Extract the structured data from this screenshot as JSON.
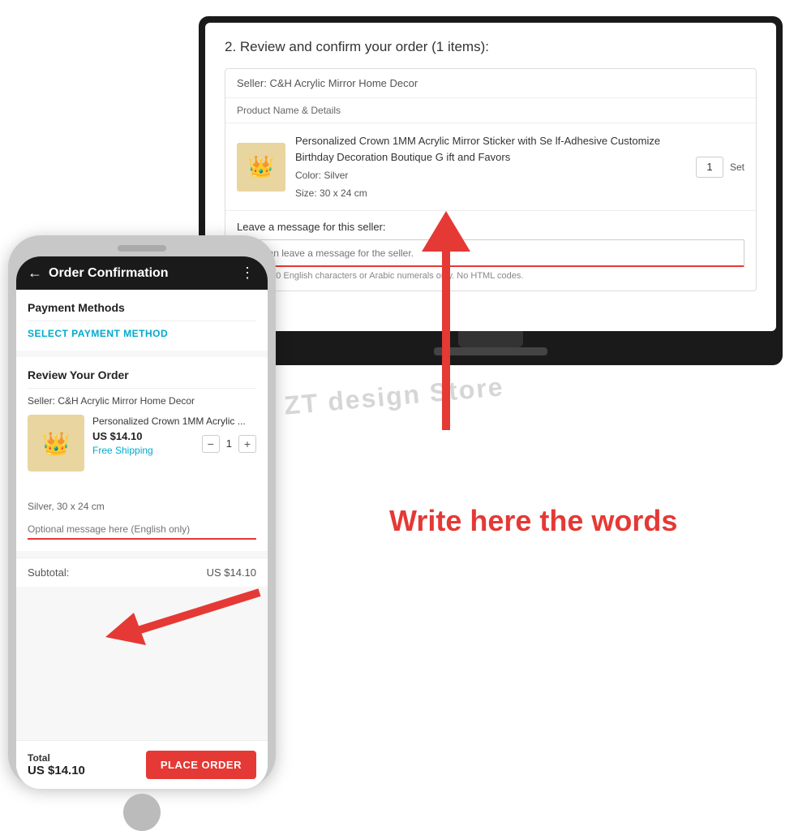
{
  "monitor": {
    "screen_title": "2. Review and confirm your order (1 items):",
    "seller_label": "Seller: C&H Acrylic Mirror Home Decor",
    "product_header": "Product Name & Details",
    "product": {
      "name": "Personalized Crown 1MM Acrylic Mirror Sticker with Se lf-Adhesive Customize Birthday Decoration Boutique G ift and Favors",
      "color_label": "Color:",
      "color_value": "Silver",
      "size_label": "Size:",
      "size_value": "30 x 24 cm",
      "qty": "1",
      "qty_unit": "Set"
    },
    "message_label": "Leave a message for this seller:",
    "message_placeholder": "You can leave a message for the seller.",
    "message_hint": "Max. 1,000 English characters or Arabic numerals only. No HTML codes.",
    "product_emoji": "👑"
  },
  "phone": {
    "back_arrow": "←",
    "title": "Order Confirmation",
    "menu_dots": "⋮",
    "payment_section_title": "Payment Methods",
    "select_payment_label": "SELECT PAYMENT METHOD",
    "review_section_title": "Review Your Order",
    "seller_label": "Seller: C&H Acrylic Mirror Home Decor",
    "product": {
      "name": "Personalized Crown 1MM Acrylic ...",
      "price": "US $14.10",
      "shipping": "Free Shipping",
      "qty": "1",
      "variant": "Silver, 30 x 24 cm",
      "emoji": "👑"
    },
    "message_placeholder": "Optional message here (English only)",
    "subtotal_label": "Subtotal:",
    "subtotal_value": "US $14.10",
    "total_label": "Total",
    "total_value": "US $14.10",
    "place_order_btn": "PLACE ORDER",
    "qty_minus": "−",
    "qty_plus": "+"
  },
  "watermark": "ZT design Store",
  "write_here": "Write here the words"
}
